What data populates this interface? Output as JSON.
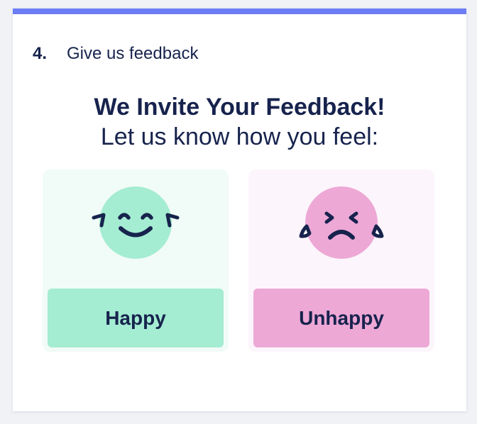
{
  "step": {
    "number": "4.",
    "title": "Give us feedback"
  },
  "heading": "We Invite Your Feedback!",
  "subheading": "Let us know how you feel:",
  "options": [
    {
      "label": "Happy",
      "icon": "happy-face-icon",
      "color": "#a4ecd2",
      "background": "#f1fbf7"
    },
    {
      "label": "Unhappy",
      "icon": "crying-face-icon",
      "color": "#eda8d6",
      "background": "#fcf5fb"
    }
  ],
  "colors": {
    "accent": "#6b7cf5",
    "text": "#17234d"
  }
}
